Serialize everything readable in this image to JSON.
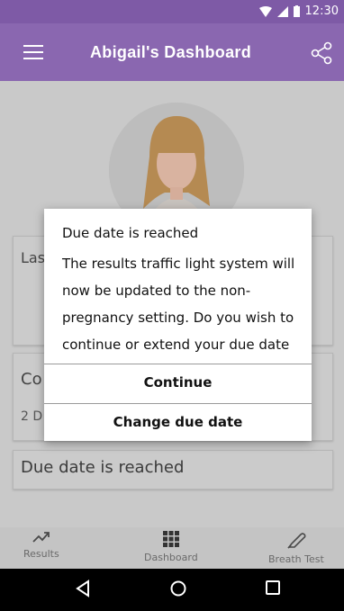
{
  "status_bar": {
    "time": "12:30"
  },
  "app_bar": {
    "title": "Abigail's  Dashboard"
  },
  "cards": {
    "last_label": "Las",
    "co_label": "Co",
    "co_sub": "2 D",
    "due_label": "Due date is reached"
  },
  "dialog": {
    "title": "Due date is reached",
    "message_lines": [
      "The results traffic light system will",
      "now be updated to the non-",
      "pregnancy setting. Do you wish to",
      "continue or extend your due date"
    ],
    "continue_label": "Continue",
    "change_label": "Change due date"
  },
  "bottom_nav": {
    "results": "Results",
    "dashboard": "Dashboard",
    "breath_test": "Breath Test"
  },
  "colors": {
    "primary": "#8a67b0",
    "status": "#7e5aa6"
  }
}
